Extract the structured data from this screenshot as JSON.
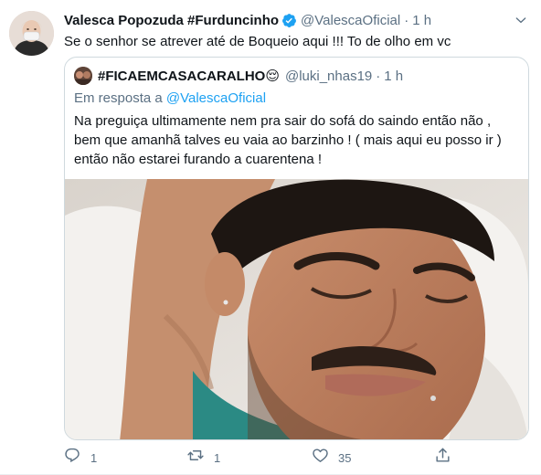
{
  "tweet": {
    "display_name": "Valesca Popozuda #Furduncinho",
    "verified": true,
    "handle": "@ValescaOficial",
    "separator": "·",
    "time": "1 h",
    "text": "Se o senhor se atrever até de Boqueio aqui !!! To de olho em vc",
    "avatar_icon": "avatar-masked-woman"
  },
  "quoted": {
    "display_name": "#FICAEMCASACARALHO",
    "emoji": "😌",
    "handle": "@luki_nhas19",
    "separator": "·",
    "time": "1 h",
    "reply_prefix": "Em resposta a",
    "reply_handle": "@ValescaOficial",
    "text_lines": [
      "Na preguiça ultimamente nem pra sair do sofá do saindo então não ,",
      "bem que amanhã talves eu vaia ao barzinho ! ( mais aqui eu posso ir )",
      "então não estarei furando a cuarentena !"
    ],
    "photo_icon": "selfie-photo-man-lying-on-pillow"
  },
  "actions": {
    "reply_count": "1",
    "retweet_count": "1",
    "like_count": "35",
    "share_count": ""
  },
  "colors": {
    "accent": "#1da1f2",
    "secondary_text": "#5b7083",
    "border": "#cfd9de"
  }
}
